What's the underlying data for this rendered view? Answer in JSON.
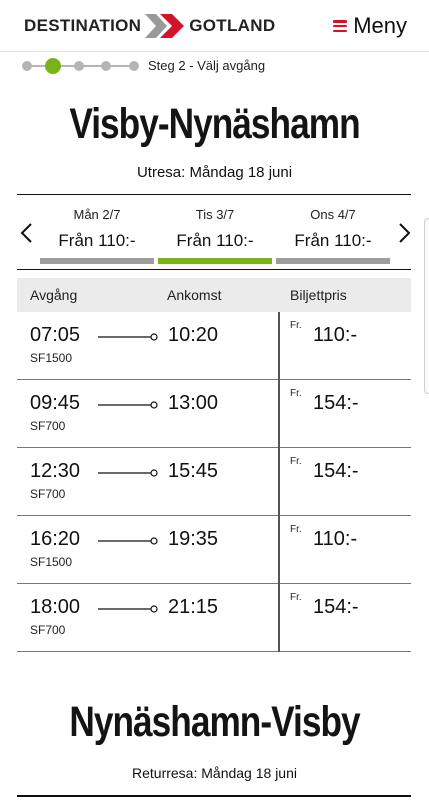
{
  "header": {
    "logo_left": "DESTINATION",
    "logo_right": "GOTLAND",
    "menu_label": "Meny",
    "accent_color": "#d2142a"
  },
  "progress": {
    "total_steps": 5,
    "current_step": 2,
    "label": "Steg 2 - Välj avgång",
    "active_color": "#7ab317"
  },
  "outbound": {
    "title": "Visby-Nynäshamn",
    "subtitle": "Utresa: Måndag 18 juni"
  },
  "date_selector": {
    "prev_icon": "chevron-left-icon",
    "next_icon": "chevron-right-icon",
    "tabs": [
      {
        "day": "Mån 2/7",
        "price": "Från 110:-",
        "selected": false
      },
      {
        "day": "Tis 3/7",
        "price": "Från 110:-",
        "selected": true
      },
      {
        "day": "Ons 4/7",
        "price": "Från 110:-",
        "selected": false
      }
    ]
  },
  "table": {
    "headers": {
      "departure": "Avgång",
      "arrival": "Ankomst",
      "price": "Biljettpris"
    },
    "price_prefix": "Fr.",
    "rows": [
      {
        "departure": "07:05",
        "ship": "SF1500",
        "arrival": "10:20",
        "price": "110:-"
      },
      {
        "departure": "09:45",
        "ship": "SF700",
        "arrival": "13:00",
        "price": "154:-"
      },
      {
        "departure": "12:30",
        "ship": "SF700",
        "arrival": "15:45",
        "price": "154:-"
      },
      {
        "departure": "16:20",
        "ship": "SF1500",
        "arrival": "19:35",
        "price": "110:-"
      },
      {
        "departure": "18:00",
        "ship": "SF700",
        "arrival": "21:15",
        "price": "154:-"
      }
    ]
  },
  "return": {
    "title": "Nynäshamn-Visby",
    "subtitle": "Returresa: Måndag 18 juni"
  }
}
